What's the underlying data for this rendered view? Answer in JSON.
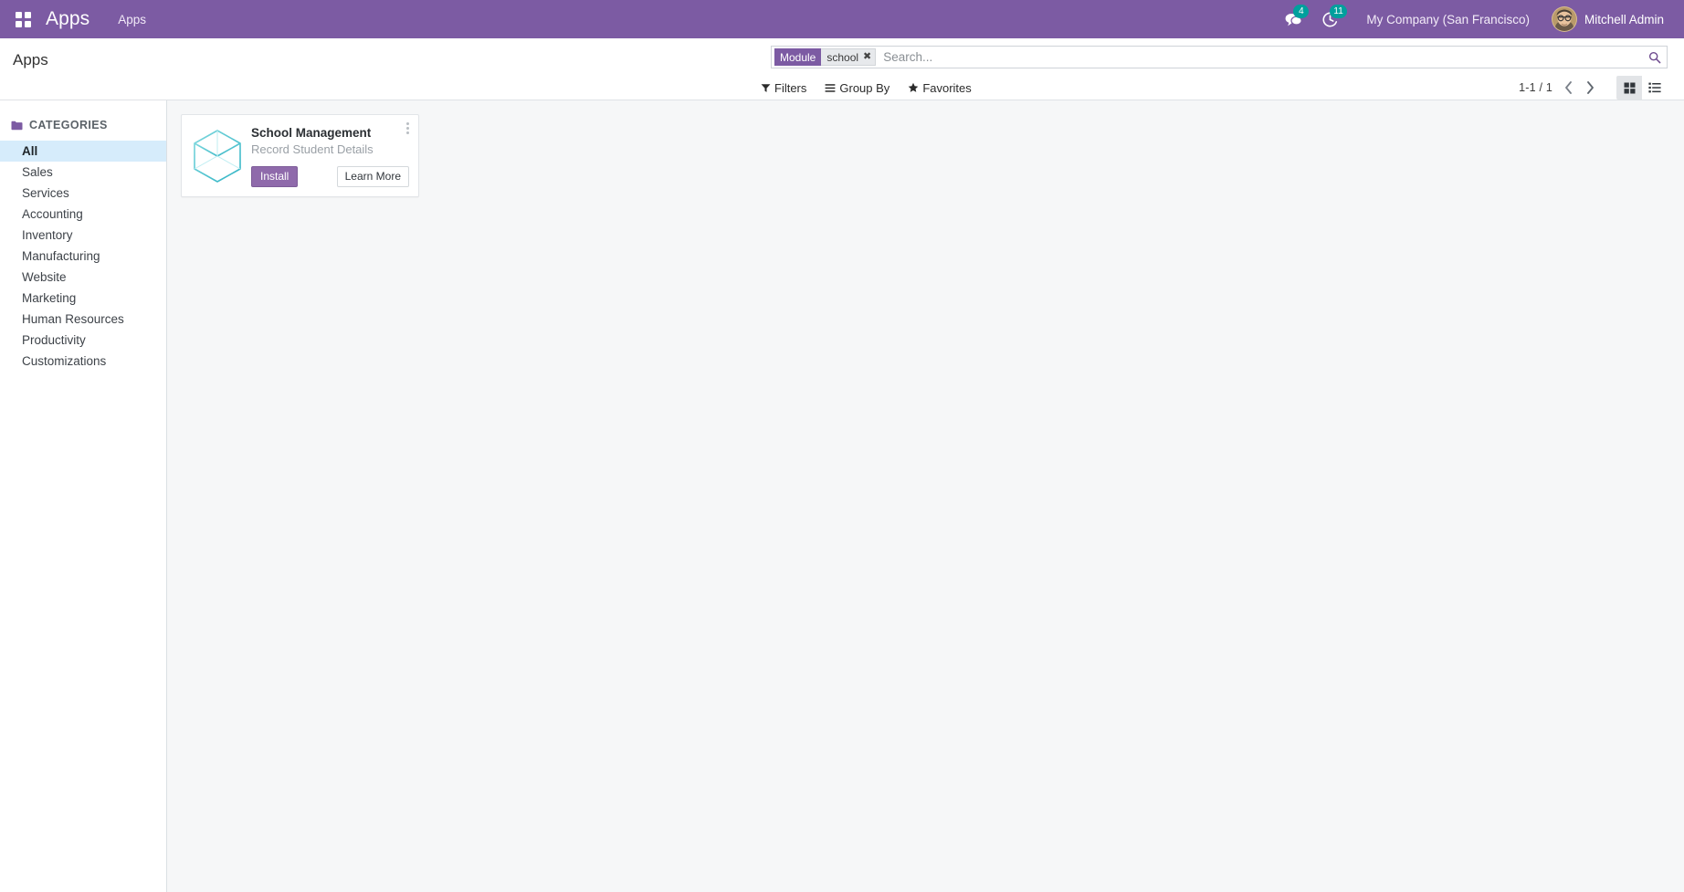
{
  "navbar": {
    "apps_menu_icon": "grid-apps-icon",
    "brand": "Apps",
    "menu_items": [
      {
        "label": "Apps",
        "name": "nav-menu-apps"
      }
    ],
    "messaging": {
      "icon": "chat-bubble-icon",
      "badge": "4",
      "badge_color": "#00a09d"
    },
    "activity": {
      "icon": "clock-activity-icon",
      "badge": "11",
      "badge_color": "#00a09d"
    },
    "company": "My Company (San Francisco)",
    "user": {
      "name": "Mitchell Admin",
      "avatar_icon": "user-avatar-photo"
    },
    "background_color": "#7c5ba3"
  },
  "control_panel": {
    "title": "Apps",
    "search": {
      "facet": {
        "label": "Module",
        "value": "school",
        "remove_icon": "facet-remove-x-icon"
      },
      "placeholder": "Search...",
      "value": "",
      "search_icon": "search-icon"
    },
    "buttons": [
      {
        "label": "Filters",
        "icon": "filter-funnel-icon",
        "name": "filters-button"
      },
      {
        "label": "Group By",
        "icon": "bars-icon",
        "name": "group-by-button"
      },
      {
        "label": "Favorites",
        "icon": "star-icon",
        "name": "favorites-button"
      }
    ],
    "pager": {
      "value": "1-1 / 1",
      "previous_icon": "chevron-left-icon",
      "next_icon": "chevron-right-icon"
    },
    "view_switcher": [
      {
        "name": "kanban-view-button",
        "icon": "kanban-grid-icon",
        "active": true
      },
      {
        "name": "list-view-button",
        "icon": "list-view-icon",
        "active": false
      }
    ]
  },
  "sidebar": {
    "section_title": "CATEGORIES",
    "section_icon": "folder-icon",
    "items": [
      {
        "label": "All",
        "selected": true
      },
      {
        "label": "Sales",
        "selected": false
      },
      {
        "label": "Services",
        "selected": false
      },
      {
        "label": "Accounting",
        "selected": false
      },
      {
        "label": "Inventory",
        "selected": false
      },
      {
        "label": "Manufacturing",
        "selected": false
      },
      {
        "label": "Website",
        "selected": false
      },
      {
        "label": "Marketing",
        "selected": false
      },
      {
        "label": "Human Resources",
        "selected": false
      },
      {
        "label": "Productivity",
        "selected": false
      },
      {
        "label": "Customizations",
        "selected": false
      }
    ],
    "selected_highlight_color": "#d6ecfb"
  },
  "apps": [
    {
      "title": "School Management",
      "subtitle": "Record Student Details",
      "icon": "module-cube-icon",
      "icon_color": "#4ec3cf",
      "install_label": "Install",
      "install_color": "#8f6aab",
      "learn_more_label": "Learn More",
      "kebab_icon": "kebab-menu-icon"
    }
  ]
}
